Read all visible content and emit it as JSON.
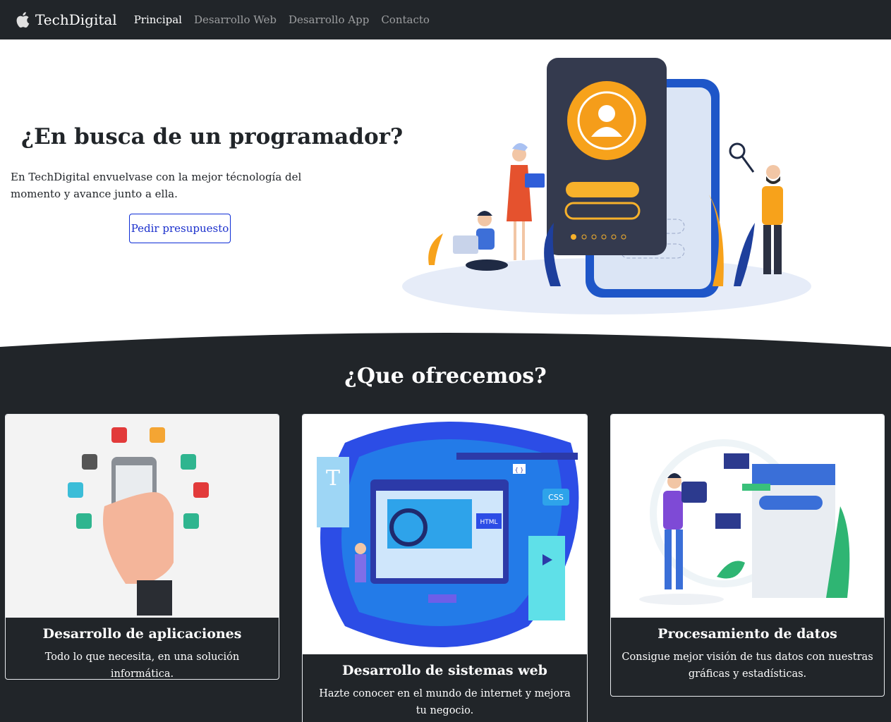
{
  "nav": {
    "brand": "TechDigital",
    "links": [
      "Principal",
      "Desarrollo Web",
      "Desarrollo App",
      "Contacto"
    ]
  },
  "hero": {
    "title": "¿En busca de un programador?",
    "text": "En TechDigital envuelvase con la mejor técnología del momento y avance junto a ella.",
    "button": "Pedir presupuesto"
  },
  "offer": {
    "title": "¿Que ofrecemos?",
    "cards": [
      {
        "title": "Desarrollo de aplicaciones",
        "text": "Todo lo que necesita, en una solución informática."
      },
      {
        "title": "Desarrollo de sistemas web",
        "text": "Hazte conocer en el mundo de internet y mejora tu negocio."
      },
      {
        "title": "Procesamiento de datos",
        "text": "Consigue mejor visión de tus datos con nuestras gráficas y estadísticas."
      }
    ]
  },
  "illustration": {
    "web_labels": [
      "T",
      "HTML",
      "CSS",
      "{ }"
    ]
  },
  "colors": {
    "dark": "#212529",
    "accent": "#1a2fcc",
    "orange": "#f7a21b",
    "blue": "#1e56c8"
  }
}
